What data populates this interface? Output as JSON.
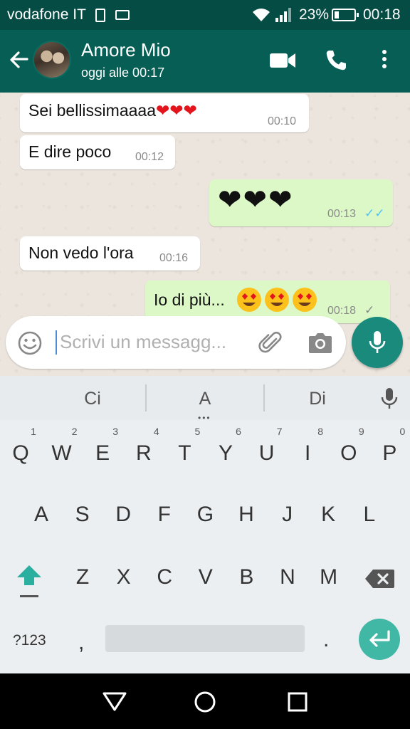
{
  "status_bar": {
    "carrier": "vodafone IT",
    "battery_percent": "23%",
    "battery_level": 0.23,
    "time": "00:18"
  },
  "header": {
    "contact_name": "Amore Mio",
    "last_seen": "oggi alle 00:17"
  },
  "messages": [
    {
      "direction": "in",
      "text": "Sei bellissimaaaa",
      "hearts": "❤❤❤",
      "time": "00:10"
    },
    {
      "direction": "in",
      "text": "E dire poco",
      "time": "00:12"
    },
    {
      "direction": "out",
      "hearts": "❤❤❤",
      "time": "00:13",
      "status": "read",
      "ticks": "✓✓",
      "tick_color": "#4fc3f7"
    },
    {
      "direction": "in",
      "text": "Non vedo l'ora",
      "time": "00:16"
    },
    {
      "direction": "out",
      "text": "Io di più...",
      "time": "00:18",
      "status": "sent",
      "ticks": "✓",
      "tick_color": "#8a8a8a"
    }
  ],
  "composer": {
    "placeholder": "Scrivi un messagg...",
    "value": ""
  },
  "keyboard": {
    "suggestions": [
      "Ci",
      "A",
      "Di"
    ],
    "row1": [
      "Q",
      "W",
      "E",
      "R",
      "T",
      "Y",
      "U",
      "I",
      "O",
      "P"
    ],
    "row1_hints": [
      "1",
      "2",
      "3",
      "4",
      "5",
      "6",
      "7",
      "8",
      "9",
      "0"
    ],
    "row2": [
      "A",
      "S",
      "D",
      "F",
      "G",
      "H",
      "J",
      "K",
      "L"
    ],
    "row3": [
      "Z",
      "X",
      "C",
      "V",
      "B",
      "N",
      "M"
    ],
    "symbols_label": "?123",
    "comma": ",",
    "period": "."
  },
  "colors": {
    "status_bar": "#054c44",
    "app_bar": "#075e54",
    "outgoing_bubble": "#dcf8c6",
    "incoming_bubble": "#ffffff",
    "mic_button": "#1a8a7c",
    "enter_key": "#41b7a5",
    "accent_shift": "#2bb0a0"
  }
}
